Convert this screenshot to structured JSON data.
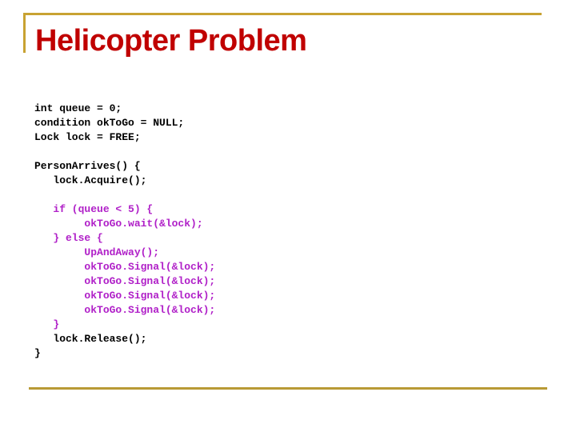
{
  "slide": {
    "title": "Helicopter Problem",
    "colors": {
      "title": "#c00000",
      "rule": "#c8a232",
      "code": "#000000",
      "highlight": "#b020c8"
    },
    "code_lines": [
      {
        "text": "int queue = 0;",
        "highlight": false
      },
      {
        "text": "condition okToGo = NULL;",
        "highlight": false
      },
      {
        "text": "Lock lock = FREE;",
        "highlight": false
      },
      {
        "text": "",
        "highlight": false
      },
      {
        "text": "PersonArrives() {",
        "highlight": false
      },
      {
        "text": "   lock.Acquire();",
        "highlight": false
      },
      {
        "text": "",
        "highlight": false
      },
      {
        "text": "   if (queue < 5) {",
        "highlight": true
      },
      {
        "text": "        okToGo.wait(&lock);",
        "highlight": true
      },
      {
        "text": "   } else {",
        "highlight": true
      },
      {
        "text": "        UpAndAway();",
        "highlight": true
      },
      {
        "text": "        okToGo.Signal(&lock);",
        "highlight": true
      },
      {
        "text": "        okToGo.Signal(&lock);",
        "highlight": true
      },
      {
        "text": "        okToGo.Signal(&lock);",
        "highlight": true
      },
      {
        "text": "        okToGo.Signal(&lock);",
        "highlight": true
      },
      {
        "text": "   }",
        "highlight": true
      },
      {
        "text": "   lock.Release();",
        "highlight": false
      },
      {
        "text": "}",
        "highlight": false
      }
    ]
  }
}
